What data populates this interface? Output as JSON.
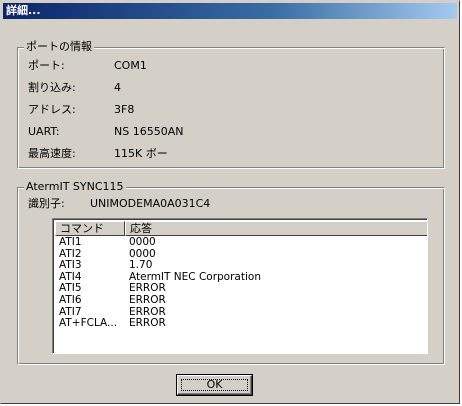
{
  "window": {
    "title": "詳細..."
  },
  "port_group": {
    "title": "ポートの情報",
    "rows": [
      {
        "label": "ポート:",
        "value": "COM1"
      },
      {
        "label": "割り込み:",
        "value": "4"
      },
      {
        "label": "アドレス:",
        "value": "3F8"
      },
      {
        "label": "UART:",
        "value": "NS 16550AN"
      },
      {
        "label": "最高速度:",
        "value": "115K ボー"
      }
    ]
  },
  "modem_group": {
    "title": "AtermIT SYNC115",
    "identifier_label": "識別子:",
    "identifier_value": "UNIMODEMA0A031C4",
    "columns": [
      "コマンド",
      "応答"
    ],
    "rows": [
      {
        "command": "ATI1",
        "response": "0000"
      },
      {
        "command": "ATI2",
        "response": "0000"
      },
      {
        "command": "ATI3",
        "response": "1.70"
      },
      {
        "command": "ATI4",
        "response": "AtermIT NEC Corporation"
      },
      {
        "command": "ATI5",
        "response": "ERROR"
      },
      {
        "command": "ATI6",
        "response": "ERROR"
      },
      {
        "command": "ATI7",
        "response": "ERROR"
      },
      {
        "command": "AT+FCLA...",
        "response": "ERROR"
      }
    ]
  },
  "buttons": {
    "ok_label": "OK"
  }
}
